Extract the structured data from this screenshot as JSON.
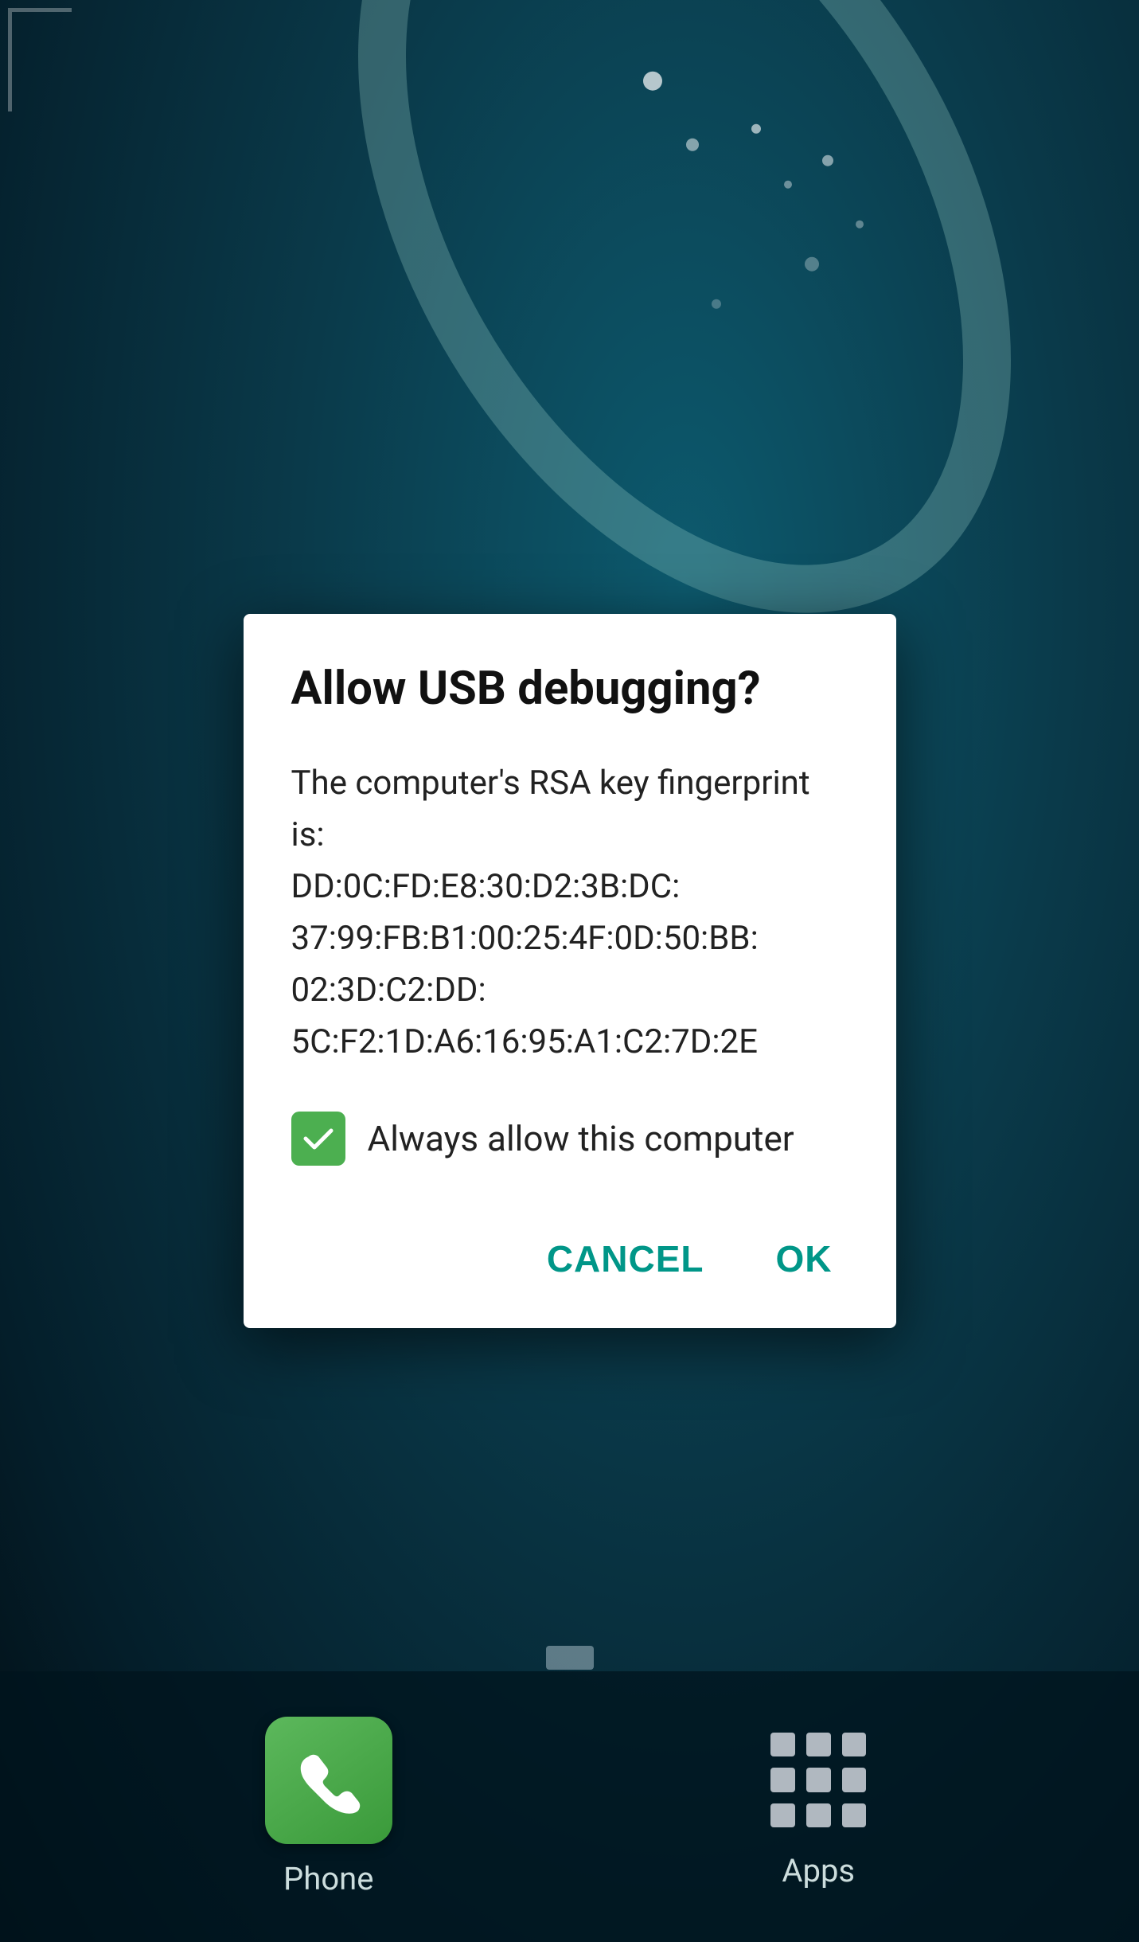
{
  "wallpaper": {
    "alt": "Dark teal space-like wallpaper"
  },
  "dialog": {
    "title": "Allow USB debugging?",
    "body": "The computer's RSA key fingerprint is:\nDD:0C:FD:E8:30:D2:3B:DC:\n37:99:FB:B1:00:25:4F:0D:50:BB:\n02:3D:C2:DD:\n5C:F2:1D:A6:16:95:A1:C2:7D:2E",
    "checkbox_label": "Always allow this computer",
    "checkbox_checked": true,
    "cancel_button": "CANCEL",
    "ok_button": "OK"
  },
  "bottom_nav": {
    "phone_label": "Phone",
    "apps_label": "Apps"
  }
}
